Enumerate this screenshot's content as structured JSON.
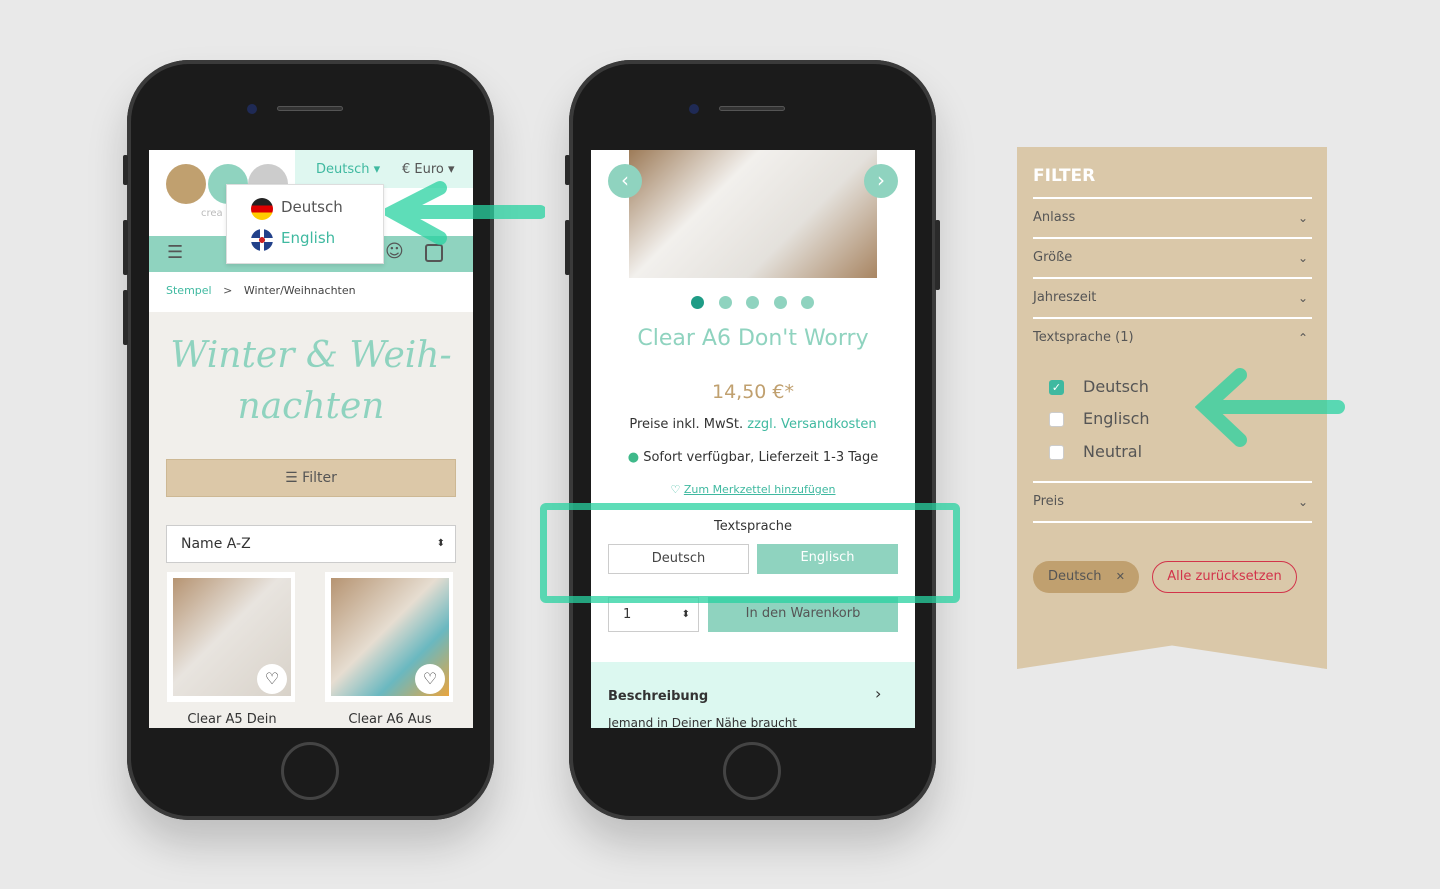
{
  "colors": {
    "accent": "#8fd3bf",
    "accent_text": "#3fb9a0",
    "gold": "#c0a06f",
    "panel": "#dac8a9",
    "reset": "#d2334a",
    "marker": "#28d2a0"
  },
  "phone1": {
    "logo_text": "crea",
    "language_select": "Deutsch",
    "currency_select": "€ Euro",
    "language_options": [
      {
        "label": "Deutsch",
        "flag": "de-flag-icon"
      },
      {
        "label": "English",
        "flag": "uk-flag-icon"
      }
    ],
    "breadcrumb": [
      "Stempel",
      "Winter/Weihnachten"
    ],
    "heading_line1": "Winter & Weih-",
    "heading_line2": "nachten",
    "filter_button": "Filter",
    "sort_value": "Name A-Z",
    "products": [
      {
        "name": "Clear A5 Dein"
      },
      {
        "name": "Clear A6 Aus"
      }
    ]
  },
  "phone2": {
    "product_title": "Clear A6 Don't Worry",
    "price": "14,50 €*",
    "tax_note": "Preise inkl. MwSt.",
    "shipping_link": "zzgl. Versandkosten",
    "availability": "Sofort verfügbar, Lieferzeit 1-3 Tage",
    "wishlist_link": "Zum Merkzettel hinzufügen",
    "variant_label": "Textsprache",
    "variants": [
      "Deutsch",
      "Englisch"
    ],
    "selected_variant": "Englisch",
    "quantity": "1",
    "add_to_cart": "In den Warenkorb",
    "description_title": "Beschreibung",
    "description_preview": "Jemand in Deiner Nähe braucht",
    "gallery_count": 5,
    "gallery_active": 1
  },
  "filter_panel": {
    "title": "FILTER",
    "groups": [
      {
        "label": "Anlass",
        "expanded": false
      },
      {
        "label": "Größe",
        "expanded": false
      },
      {
        "label": "Jahreszeit",
        "expanded": false
      },
      {
        "label": "Textsprache (1)",
        "expanded": true
      },
      {
        "label": "Preis",
        "expanded": false
      }
    ],
    "options": [
      {
        "label": "Deutsch",
        "checked": true
      },
      {
        "label": "Englisch",
        "checked": false
      },
      {
        "label": "Neutral",
        "checked": false
      }
    ],
    "active_tag": "Deutsch",
    "reset_button": "Alle zurücksetzen"
  }
}
